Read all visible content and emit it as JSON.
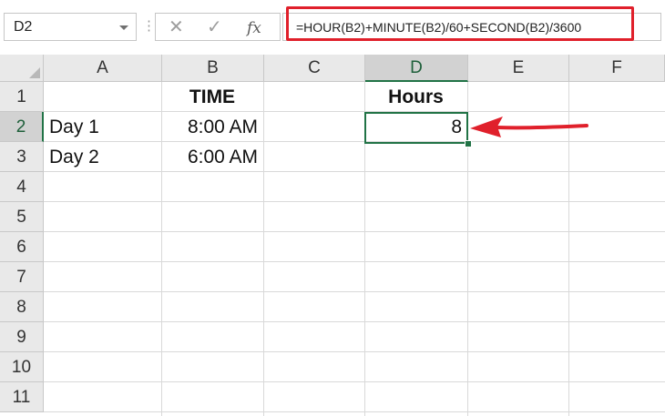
{
  "formula_bar": {
    "name_box": "D2",
    "separator": "⋮",
    "cancel_symbol": "✕",
    "enter_symbol": "✓",
    "fx_symbol": "fx",
    "formula": "=HOUR(B2)+MINUTE(B2)/60+SECOND(B2)/3600"
  },
  "columns": [
    "A",
    "B",
    "C",
    "D",
    "E",
    "F"
  ],
  "rows": [
    "1",
    "2",
    "3",
    "4",
    "5",
    "6",
    "7",
    "8",
    "9",
    "10",
    "11"
  ],
  "active_cell": "D2",
  "cells": {
    "B1": "TIME",
    "D1": "Hours",
    "A2": "Day 1",
    "B2": "8:00 AM",
    "D2": "8",
    "A3": "Day 2",
    "B3": "6:00 AM"
  },
  "colors": {
    "highlight_border": "#e0202b",
    "selection": "#217346",
    "arrow": "#e0202b"
  }
}
